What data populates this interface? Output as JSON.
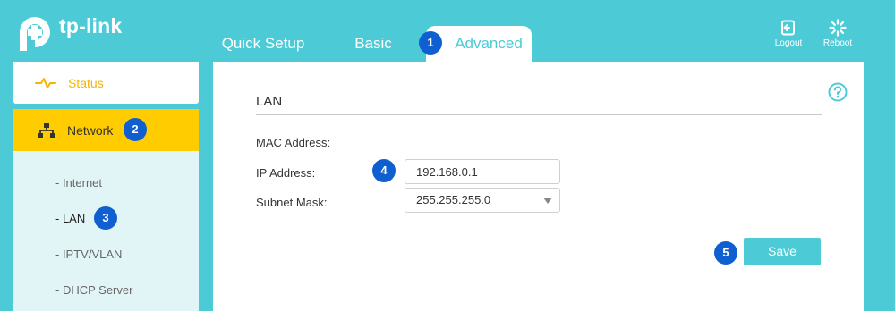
{
  "brand": {
    "name": "tp-link"
  },
  "tabs": [
    {
      "label": "Quick Setup"
    },
    {
      "label": "Basic"
    },
    {
      "label": "Advanced",
      "active": true
    }
  ],
  "header_buttons": {
    "logout": "Logout",
    "reboot": "Reboot"
  },
  "sidebar": {
    "status": "Status",
    "network": "Network",
    "network_subitems": [
      {
        "label": "- Internet"
      },
      {
        "label": "- LAN",
        "active": true
      },
      {
        "label": "- IPTV/VLAN"
      },
      {
        "label": "- DHCP Server"
      }
    ]
  },
  "main": {
    "section_title": "LAN",
    "fields": {
      "mac_label": "MAC Address:",
      "ip_label": "IP Address:",
      "ip_value": "192.168.0.1",
      "mask_label": "Subnet Mask:",
      "mask_value": "255.255.255.0"
    },
    "save_label": "Save"
  },
  "steps": [
    "1",
    "2",
    "3",
    "4",
    "5"
  ],
  "colors": {
    "accent": "#4ccbd6",
    "network_highlight": "#ffcc00",
    "status_text": "#f7b500",
    "badge": "#0f5fd1"
  },
  "icons": [
    "tp-link-logo-icon",
    "logout-icon",
    "reboot-icon",
    "pulse-icon",
    "network-topology-icon",
    "help-icon",
    "dropdown-caret-icon"
  ]
}
